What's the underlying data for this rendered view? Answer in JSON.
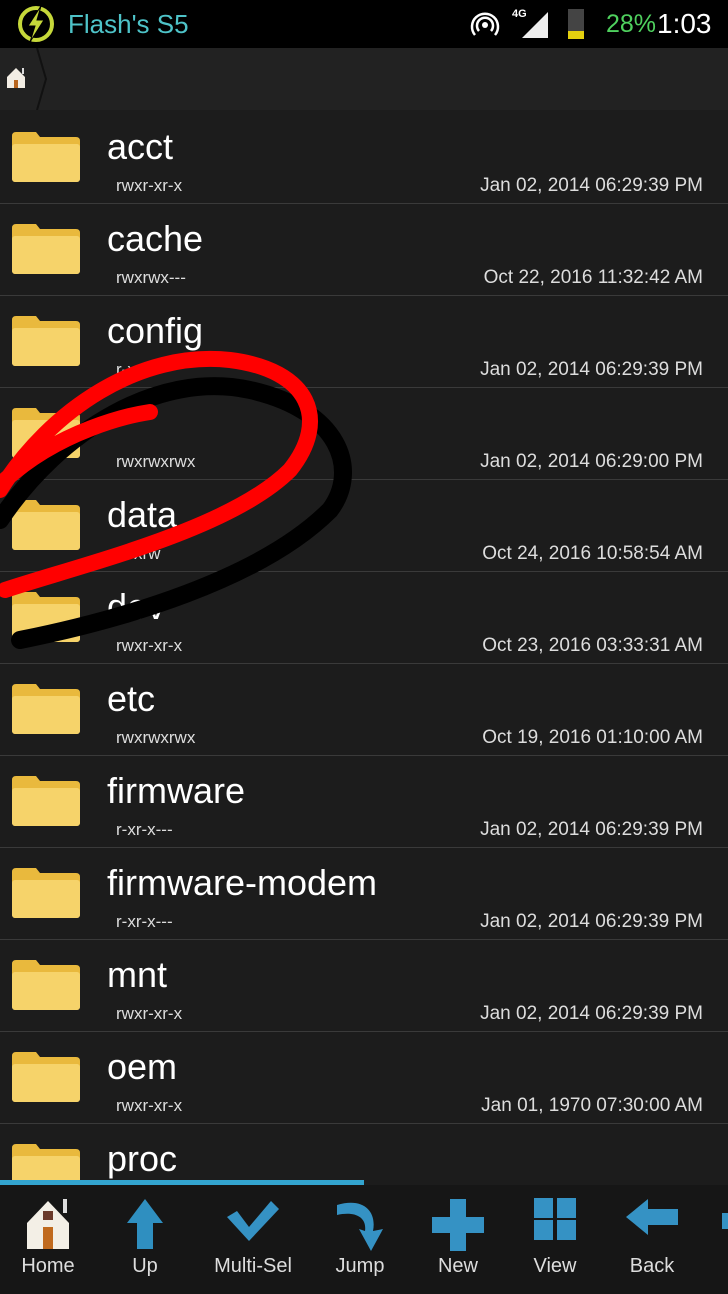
{
  "status_bar": {
    "device_name": "Flash's S5",
    "network": "4G",
    "battery": "28%",
    "time": "1:03",
    "battery_level": 0.28,
    "accent": "#4ec3c8"
  },
  "breadcrumb": {
    "icon": "home-icon"
  },
  "files": [
    {
      "name": "acct",
      "perm": "rwxr-xr-x",
      "date": "Jan 02, 2014 06:29:39 PM"
    },
    {
      "name": "cache",
      "perm": "rwxrwx---",
      "date": "Oct 22, 2016 11:32:42 AM"
    },
    {
      "name": "config",
      "perm": "r-x---",
      "date": "Jan 02, 2014 06:29:39 PM"
    },
    {
      "name": "",
      "perm": "rwxrwxrwx",
      "date": "Jan 02, 2014 06:29:00 PM"
    },
    {
      "name": "data",
      "perm": "rwxrw",
      "date": "Oct 24, 2016 10:58:54 AM"
    },
    {
      "name": "dev",
      "perm": "rwxr-xr-x",
      "date": "Oct 23, 2016 03:33:31 AM"
    },
    {
      "name": "etc",
      "perm": "rwxrwxrwx",
      "date": "Oct 19, 2016 01:10:00 AM"
    },
    {
      "name": "firmware",
      "perm": "r-xr-x---",
      "date": "Jan 02, 2014 06:29:39 PM"
    },
    {
      "name": "firmware-modem",
      "perm": "r-xr-x---",
      "date": "Jan 02, 2014 06:29:39 PM"
    },
    {
      "name": "mnt",
      "perm": "rwxr-xr-x",
      "date": "Jan 02, 2014 06:29:39 PM"
    },
    {
      "name": "oem",
      "perm": "rwxr-xr-x",
      "date": "Jan 01, 1970 07:30:00 AM"
    },
    {
      "name": "proc",
      "perm": "",
      "date": ""
    }
  ],
  "scroll_progress": 0.5,
  "toolbar": {
    "home": "Home",
    "up": "Up",
    "multisel": "Multi-Sel",
    "jump": "Jump",
    "new": "New",
    "view": "View",
    "back": "Back"
  }
}
